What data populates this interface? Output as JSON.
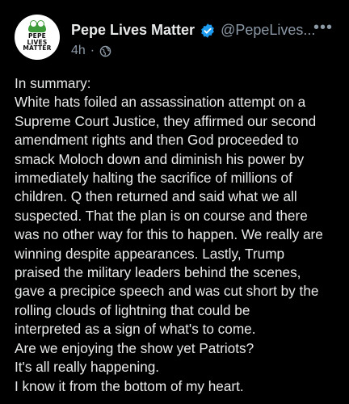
{
  "post": {
    "avatar": {
      "logo_lines": [
        "PEPE",
        "LIVES",
        "MATTER"
      ],
      "brand_color": "#3e9b3a"
    },
    "author": {
      "display_name": "Pepe Lives Matter",
      "handle": "@PepeLives...",
      "verified_icon": "verified-badge-icon",
      "verified_color": "#1d9bf0"
    },
    "more_icon": "more-options-icon",
    "meta": {
      "time": "4h",
      "separator": "·",
      "audience_icon": "globe-icon"
    },
    "body_lines": [
      "In summary:",
      "White hats foiled an assassination attempt on a",
      "Supreme Court Justice, they affirmed our second",
      "amendment rights and then God proceeded to",
      "smack Moloch down and diminish his power by",
      "immediately halting the sacrifice of millions of",
      "children. Q then returned and said what we all",
      "suspected. That the plan is on course and there",
      "was no other way for this to happen. We really are",
      "winning despite appearances. Lastly, Trump",
      "praised the military leaders behind the scenes,",
      "gave a precipice speech and was cut short by the",
      "rolling clouds of lightning that could be",
      "interpreted as a sign of what's to come.",
      "Are we enjoying the show yet Patriots?",
      "It's all really happening.",
      "I know it from the bottom of my heart."
    ],
    "colors": {
      "background": "#000000",
      "text": "#e7e9ea",
      "secondary_text": "#8b98a5"
    }
  }
}
